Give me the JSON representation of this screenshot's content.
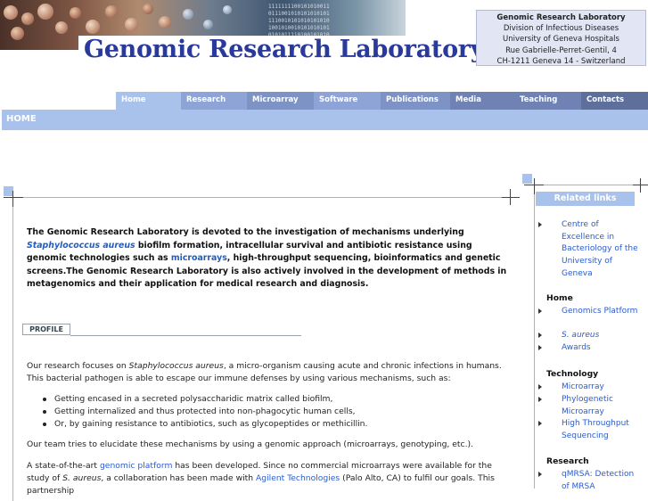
{
  "site_title": "Genomic Research Laboratory",
  "address": {
    "line1": "Genomic Research Laboratory",
    "line2": "Division of Infectious Diseases",
    "line3": "University of Geneva Hospitals",
    "line4": "Rue Gabrielle-Perret-Gentil, 4",
    "line5": "CH-1211 Geneva 14 - Switzerland"
  },
  "nav": [
    {
      "label": "Home",
      "color": "#a9c2eb"
    },
    {
      "label": "Research",
      "color": "#8ea4d6"
    },
    {
      "label": "Microarray",
      "color": "#7e93c5"
    },
    {
      "label": "Software",
      "color": "#8ea4d6"
    },
    {
      "label": "Publications",
      "color": "#7e93c5"
    },
    {
      "label": "Media",
      "color": "#6f82b3"
    },
    {
      "label": "Teaching",
      "color": "#6f82b3"
    },
    {
      "label": "Contacts",
      "color": "#5e6f9c"
    }
  ],
  "section_title": "HOME",
  "intro": {
    "t1": "The Genomic Research Laboratory is devoted to the investigation of mechanisms underlying ",
    "link1": "Staphylococcus aureus",
    "t2": " biofilm formation, intracellular survival and antibiotic resistance using genomic technologies such as ",
    "link2": "microarrays",
    "t3": ", high-throughput sequencing, bioinformatics and genetic screens.The Genomic Research Laboratory is also actively involved in the development of methods in metagenomics and their application for medical research and diagnosis."
  },
  "profile_tab": "PROFILE",
  "p1": {
    "t1": "Our research focuses on ",
    "species": "Staphylococcus aureus",
    "t2": ", a micro-organism causing acute and chronic infections in humans. This bacterial pathogen is able to escape our immune defenses by using various mechanisms, such as:"
  },
  "bullets": [
    "Getting encased in a secreted polysaccharidic matrix called biofilm,",
    "Getting internalized and thus protected into non-phagocytic human cells,",
    "Or, by gaining resistance to antibiotics, such as glycopeptides or methicillin."
  ],
  "p2": "Our team tries to elucidate these mechanisms by using a genomic approach (microarrays, genotyping, etc.).",
  "p3": {
    "t1": "A state-of-the-art ",
    "link1": "genomic platform",
    "t2": " has been developed. Since no commercial microarrays were available for the study of ",
    "species": "S. aureus",
    "t3": ", a collaboration has been made with ",
    "link2": "Agilent Technologies",
    "t4": " (Palo Alto, CA) to fulfil our goals. This partnership"
  },
  "sidebar": {
    "header": "Related links",
    "related": [
      "Centre of Excellence in Bacteriology of the University of Geneva"
    ],
    "home_heading": "Home",
    "home_items": [
      "Genomics Platform",
      "S. aureus",
      "Awards"
    ],
    "technology_heading": "Technology",
    "technology_items": [
      "Microarray",
      "Phylogenetic Microarray",
      "High Throughput Sequencing"
    ],
    "research_heading": "Research",
    "research_items": [
      "qMRSA: Detection of MRSA"
    ]
  },
  "banner_binary": "1111111100101010011\n0111001010101010101\n1110010101010101010\n1001010010101010101\n0101011110100101010\n1010101001010101001\n0001000110001010100"
}
